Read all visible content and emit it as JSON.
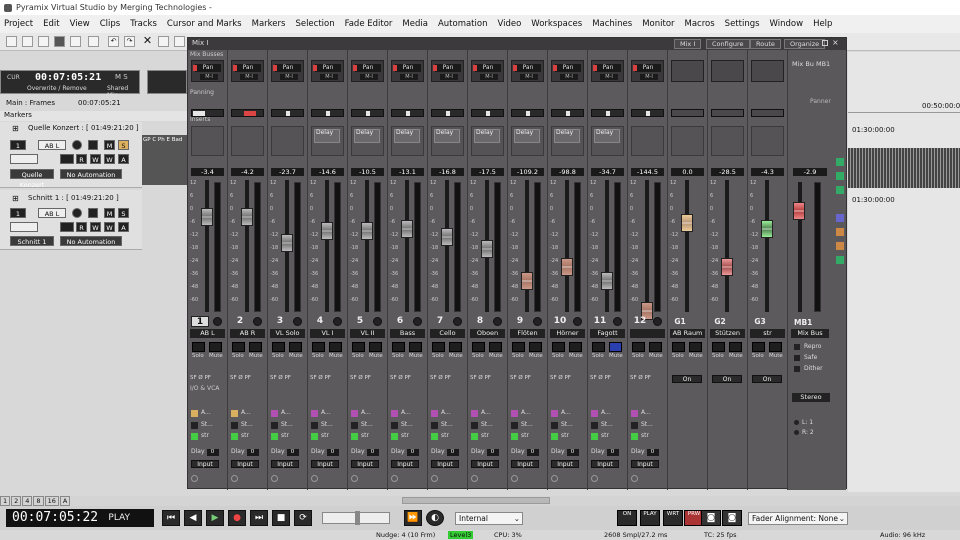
{
  "window": {
    "title": "Pyramix Virtual Studio by Merging Technologies -"
  },
  "menu": [
    "Project",
    "Edit",
    "View",
    "Clips",
    "Tracks",
    "Cursor and Marks",
    "Markers",
    "Selection",
    "Fade Editor",
    "Media",
    "Automation",
    "Video",
    "Workspaces",
    "Machines",
    "Monitor",
    "Macros",
    "Settings",
    "Window",
    "Help"
  ],
  "left": {
    "cur_label": "CUR",
    "timecode": "00:07:05:21",
    "mode": "Overwrite / Remove",
    "shared": "Shared Mix",
    "ms": "M S",
    "main_frames": "Main : Frames",
    "main_tc": "00:07:05:21",
    "markers": "Markers"
  },
  "tracks": [
    {
      "title": "Quelle Konzert : [ 01:49:21:20 ]",
      "ab": "AB L",
      "name": "Quelle Konzert",
      "auto": "No Automation",
      "clip": "GP C Ph E Bad"
    },
    {
      "title": "Schnitt 1 : [ 01:49:21:20 ]",
      "ab": "AB L",
      "name": "Schnitt 1",
      "auto": "No Automation",
      "clip": ""
    }
  ],
  "buttons": {
    "m": "M",
    "s": "S",
    "r": "R",
    "w": "W",
    "a": "A"
  },
  "ruler": {
    "t1": "00:50:00:00",
    "t2": "01:30:00:00",
    "t3": "01:30:00:00"
  },
  "mixer": {
    "title": "Mix I",
    "tabs": [
      "Mix I",
      "Configure",
      "Route",
      "Organize"
    ],
    "sections": {
      "busses": "Mix Busses",
      "panning": "Panning",
      "inserts": "Inserts",
      "vca": "I/O & VCA"
    },
    "mixbus_label": "Mix Bu MB1",
    "panner_label": "Panner",
    "pan_text": "Pan",
    "lr_text": "M-I",
    "delay_text": "Delay",
    "solo": "Solo",
    "mute": "Mute",
    "sfp": "SF Ø PF",
    "on": "On",
    "dlay": "Dlay",
    "dlay_val": "0",
    "input": "Input",
    "vca_a": "A...",
    "vca_st": "St...",
    "vca_str": "str",
    "scale": [
      "12",
      "6",
      "0",
      "-6",
      "-12",
      "-18",
      "-24",
      "-36",
      "-48",
      "-60"
    ],
    "channels": [
      {
        "num": "1",
        "gain": "-3.4",
        "name": "AB L",
        "delay": ""
      },
      {
        "num": "2",
        "gain": "-4.2",
        "name": "AB R",
        "delay": ""
      },
      {
        "num": "3",
        "gain": "-23.7",
        "name": "VL Solo",
        "delay": ""
      },
      {
        "num": "4",
        "gain": "-14.6",
        "name": "VL I",
        "delay": "Delay"
      },
      {
        "num": "5",
        "gain": "-10.5",
        "name": "VL II",
        "delay": "Delay"
      },
      {
        "num": "6",
        "gain": "-13.1",
        "name": "Bass",
        "delay": "Delay"
      },
      {
        "num": "7",
        "gain": "-16.8",
        "name": "Cello",
        "delay": "Delay"
      },
      {
        "num": "8",
        "gain": "-17.5",
        "name": "Oboen",
        "delay": "Delay"
      },
      {
        "num": "9",
        "gain": "-109.2",
        "name": "Flöten",
        "delay": "Delay"
      },
      {
        "num": "10",
        "gain": "-98.8",
        "name": "Hörner",
        "delay": "Delay"
      },
      {
        "num": "11",
        "gain": "-34.7",
        "name": "Fagott",
        "delay": "Delay"
      },
      {
        "num": "12",
        "gain": "-144.5",
        "name": "",
        "delay": ""
      }
    ],
    "groups": [
      {
        "num": "G1",
        "gain": "0.0",
        "name": "AB Raum"
      },
      {
        "num": "G2",
        "gain": "-28.5",
        "name": "Stützen"
      },
      {
        "num": "G3",
        "gain": "-4.3",
        "name": "str"
      }
    ],
    "mixbus": {
      "num": "MB1",
      "gain": "-2.9",
      "name": "Mix Bus",
      "repro": "Repro",
      "safe": "Safe",
      "dither": "Dither",
      "stereo": "Stereo",
      "l": "L: 1",
      "r": "R: 2"
    }
  },
  "bottom": {
    "zoom_tabs": [
      "1",
      "2",
      "4",
      "8",
      "16",
      "A"
    ],
    "timecode": "00:07:05:22",
    "state": "PLAY",
    "sync": "Internal",
    "fader_alignment": "Fader Alignment: None",
    "smpte_btns": [
      "ON",
      "PLAY",
      "WRT",
      "PRW"
    ]
  },
  "status": {
    "nudge": "Nudge: 4 (10 Frm)",
    "level": "Level3",
    "cpu": "CPU: 3%",
    "disk": "2608 Smpl/27.2 ms",
    "tc": "TC: 25 fps",
    "audio": "Audio: 96 kHz"
  }
}
